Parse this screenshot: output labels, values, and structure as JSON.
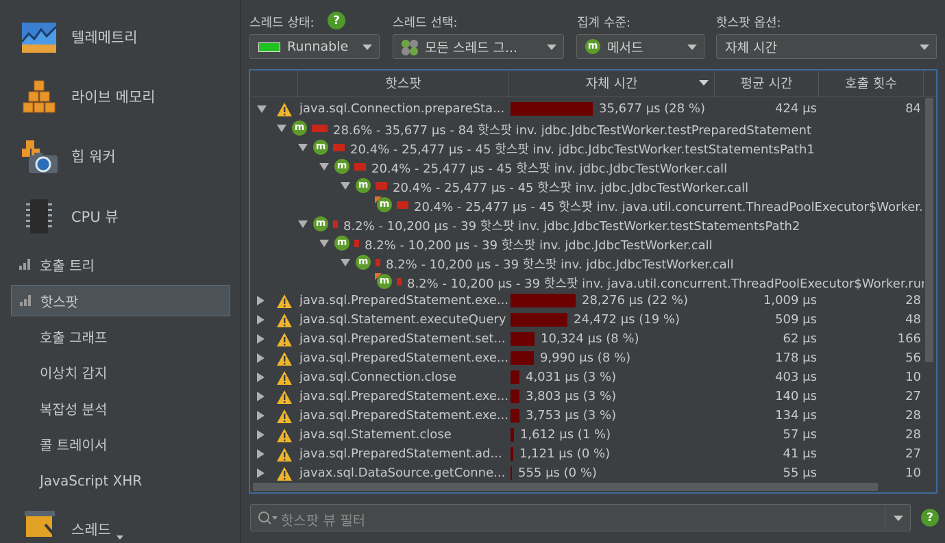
{
  "sidebar": {
    "big_items": [
      {
        "label": "텔레메트리",
        "icon": "telemetry-icon"
      },
      {
        "label": "라이브 메모리",
        "icon": "live-memory-icon"
      },
      {
        "label": "힙 워커",
        "icon": "heap-walker-icon"
      },
      {
        "label": "CPU 뷰",
        "icon": "cpu-icon"
      }
    ],
    "small_items": [
      {
        "label": "호출 트리"
      },
      {
        "label": "핫스팟"
      },
      {
        "label": "호출 그래프"
      },
      {
        "label": "이상치 감지"
      },
      {
        "label": "복잡성 분석"
      },
      {
        "label": "콜 트레이서"
      },
      {
        "label": "JavaScript XHR"
      }
    ],
    "bottom_item": {
      "label": "스레드"
    }
  },
  "options": {
    "thread_state_label": "스레드 상태:",
    "thread_state_value": "Runnable",
    "thread_select_label": "스레드 선택:",
    "thread_select_value": "모든 스레드 그...",
    "aggregation_label": "집계 수준:",
    "aggregation_value": "메서드",
    "hotspot_option_label": "핫스팟 옵션:",
    "hotspot_option_value": "자체 시간",
    "help": "?",
    "method_badge": "m"
  },
  "table": {
    "columns": [
      "핫스팟",
      "자체 시간",
      "평균 시간",
      "호출 횟수"
    ],
    "top_rows_first": {
      "name": "java.sql.Connection.prepareSta...",
      "self": "35,677 μs (28 %)",
      "bar_frac": 1.0,
      "avg": "424 μs",
      "count": "84"
    },
    "backtraces": [
      "28.6% - 35,677 μs - 84 핫스팟 inv. jdbc.JdbcTestWorker.testPreparedStatement",
      "20.4% - 25,477 μs - 45 핫스팟 inv. jdbc.JdbcTestWorker.testStatementsPath1",
      "20.4% - 25,477 μs - 45 핫스팟 inv. jdbc.JdbcTestWorker.call",
      "20.4% - 25,477 μs - 45 핫스팟 inv. jdbc.JdbcTestWorker.call",
      "20.4% - 25,477 μs - 45 핫스팟 inv. java.util.concurrent.ThreadPoolExecutor$Worker.run",
      "8.2% - 10,200 μs - 39 핫스팟 inv. jdbc.JdbcTestWorker.testStatementsPath2",
      "8.2% - 10,200 μs - 39 핫스팟 inv. jdbc.JdbcTestWorker.call",
      "8.2% - 10,200 μs - 39 핫스팟 inv. jdbc.JdbcTestWorker.call",
      "8.2% - 10,200 μs - 39 핫스팟 inv. java.util.concurrent.ThreadPoolExecutor$Worker.run"
    ],
    "rows": [
      {
        "name": "java.sql.PreparedStatement.exe...",
        "self": "28,276 μs (22 %)",
        "bar_frac": 0.79,
        "avg": "1,009 μs",
        "count": "28"
      },
      {
        "name": "java.sql.Statement.executeQuery",
        "self": "24,472 μs (19 %)",
        "bar_frac": 0.69,
        "avg": "509 μs",
        "count": "48"
      },
      {
        "name": "java.sql.PreparedStatement.set...",
        "self": "10,324 μs (8 %)",
        "bar_frac": 0.29,
        "avg": "62 μs",
        "count": "166"
      },
      {
        "name": "java.sql.PreparedStatement.exe...",
        "self": "9,990 μs (8 %)",
        "bar_frac": 0.28,
        "avg": "178 μs",
        "count": "56"
      },
      {
        "name": "java.sql.Connection.close",
        "self": "4,031 μs (3 %)",
        "bar_frac": 0.11,
        "avg": "403 μs",
        "count": "10"
      },
      {
        "name": "java.sql.PreparedStatement.exe...",
        "self": "3,803 μs (3 %)",
        "bar_frac": 0.107,
        "avg": "140 μs",
        "count": "27"
      },
      {
        "name": "java.sql.PreparedStatement.exe...",
        "self": "3,753 μs (3 %)",
        "bar_frac": 0.105,
        "avg": "134 μs",
        "count": "28"
      },
      {
        "name": "java.sql.Statement.close",
        "self": "1,612 μs (1 %)",
        "bar_frac": 0.045,
        "avg": "57 μs",
        "count": "28"
      },
      {
        "name": "java.sql.PreparedStatement.ad...",
        "self": "1,121 μs (0 %)",
        "bar_frac": 0.031,
        "avg": "41 μs",
        "count": "27"
      },
      {
        "name": "javax.sql.DataSource.getConne...",
        "self": "555 μs (0 %)",
        "bar_frac": 0.016,
        "avg": "55 μs",
        "count": "10"
      }
    ]
  },
  "filter": {
    "placeholder": "핫스팟 뷰 필터"
  }
}
